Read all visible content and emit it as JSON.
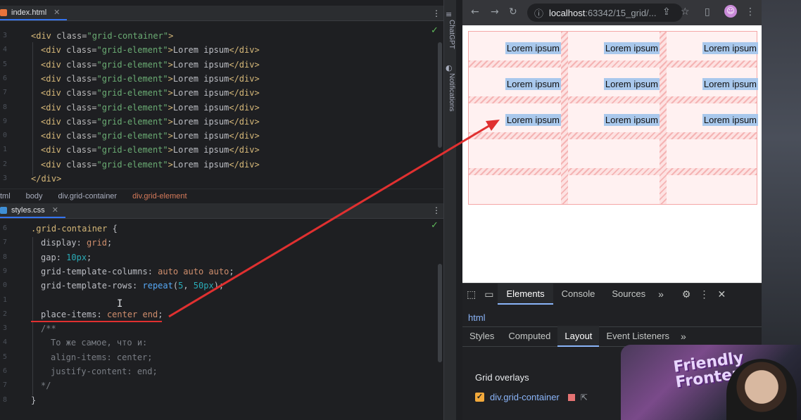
{
  "ide": {
    "html_tab": {
      "label": "index.html"
    },
    "css_tab": {
      "label": "styles.css"
    },
    "html_lines": [
      {
        "n": "3",
        "ind": 0,
        "parts": [
          [
            "tag",
            "<div "
          ],
          [
            "attr",
            "class="
          ],
          [
            "val",
            "\"grid-container\""
          ],
          [
            "tag",
            ">"
          ]
        ]
      },
      {
        "n": "4",
        "ind": 1,
        "parts": [
          [
            "tag",
            "<div "
          ],
          [
            "attr",
            "class="
          ],
          [
            "val",
            "\"grid-element\""
          ],
          [
            "tag",
            ">"
          ],
          [
            "text",
            "Lorem ipsum"
          ],
          [
            "tag",
            "</div>"
          ]
        ]
      },
      {
        "n": "5",
        "ind": 1,
        "parts": [
          [
            "tag",
            "<div "
          ],
          [
            "attr",
            "class="
          ],
          [
            "val",
            "\"grid-element\""
          ],
          [
            "tag",
            ">"
          ],
          [
            "text",
            "Lorem ipsum"
          ],
          [
            "tag",
            "</div>"
          ]
        ]
      },
      {
        "n": "6",
        "ind": 1,
        "parts": [
          [
            "tag",
            "<div "
          ],
          [
            "attr",
            "class="
          ],
          [
            "val",
            "\"grid-element\""
          ],
          [
            "tag",
            ">"
          ],
          [
            "text",
            "Lorem ipsum"
          ],
          [
            "tag",
            "</div>"
          ]
        ]
      },
      {
        "n": "7",
        "ind": 1,
        "parts": [
          [
            "tag",
            "<div "
          ],
          [
            "attr",
            "class="
          ],
          [
            "val",
            "\"grid-element\""
          ],
          [
            "tag",
            ">"
          ],
          [
            "text",
            "Lorem ipsum"
          ],
          [
            "tag",
            "</div>"
          ]
        ]
      },
      {
        "n": "8",
        "ind": 1,
        "parts": [
          [
            "tag",
            "<div "
          ],
          [
            "attr",
            "class="
          ],
          [
            "val",
            "\"grid-element\""
          ],
          [
            "tag",
            ">"
          ],
          [
            "text",
            "Lorem ipsum"
          ],
          [
            "tag",
            "</div>"
          ]
        ]
      },
      {
        "n": "9",
        "ind": 1,
        "parts": [
          [
            "tag",
            "<div "
          ],
          [
            "attr",
            "class="
          ],
          [
            "val",
            "\"grid-element\""
          ],
          [
            "tag",
            ">"
          ],
          [
            "text",
            "Lorem ipsum"
          ],
          [
            "tag",
            "</div>"
          ]
        ]
      },
      {
        "n": "0",
        "ind": 1,
        "parts": [
          [
            "tag",
            "<div "
          ],
          [
            "attr",
            "class="
          ],
          [
            "val",
            "\"grid-element\""
          ],
          [
            "tag",
            ">"
          ],
          [
            "text",
            "Lorem ipsum"
          ],
          [
            "tag",
            "</div>"
          ]
        ]
      },
      {
        "n": "1",
        "ind": 1,
        "parts": [
          [
            "tag",
            "<div "
          ],
          [
            "attr",
            "class="
          ],
          [
            "val",
            "\"grid-element\""
          ],
          [
            "tag",
            ">"
          ],
          [
            "text",
            "Lorem ipsum"
          ],
          [
            "tag",
            "</div>"
          ]
        ]
      },
      {
        "n": "2",
        "ind": 1,
        "parts": [
          [
            "tag",
            "<div "
          ],
          [
            "attr",
            "class="
          ],
          [
            "val",
            "\"grid-element\""
          ],
          [
            "tag",
            ">"
          ],
          [
            "text",
            "Lorem ipsum"
          ],
          [
            "tag",
            "</div>"
          ]
        ]
      },
      {
        "n": "3",
        "ind": 0,
        "parts": [
          [
            "tag",
            "</div>"
          ]
        ]
      }
    ],
    "breadcrumbs": [
      "tml",
      "body",
      "div.grid-container",
      "div.grid-element"
    ],
    "css_lines": [
      {
        "n": "6",
        "ind": 0,
        "parts": [
          [
            "sel",
            ".grid-container "
          ],
          [
            "text",
            "{"
          ]
        ]
      },
      {
        "n": "7",
        "ind": 1,
        "parts": [
          [
            "prop",
            "display"
          ],
          [
            "text",
            ": "
          ],
          [
            "kw",
            "grid"
          ],
          [
            "text",
            ";"
          ]
        ]
      },
      {
        "n": "8",
        "ind": 1,
        "parts": [
          [
            "prop",
            "gap"
          ],
          [
            "text",
            ": "
          ],
          [
            "num",
            "10px"
          ],
          [
            "text",
            ";"
          ]
        ]
      },
      {
        "n": "9",
        "ind": 1,
        "parts": [
          [
            "prop",
            "grid-template-columns"
          ],
          [
            "text",
            ": "
          ],
          [
            "kw",
            "auto auto auto"
          ],
          [
            "text",
            ";"
          ]
        ]
      },
      {
        "n": "0",
        "ind": 1,
        "parts": [
          [
            "prop",
            "grid-template-rows"
          ],
          [
            "text",
            ": "
          ],
          [
            "fn",
            "repeat"
          ],
          [
            "text",
            "("
          ],
          [
            "num",
            "5"
          ],
          [
            "text",
            ", "
          ],
          [
            "num",
            "50px"
          ],
          [
            "text",
            ");"
          ]
        ]
      },
      {
        "n": "1",
        "ind": 0,
        "parts": []
      },
      {
        "n": "2",
        "ind": 1,
        "parts": [
          [
            "prop",
            "place-items"
          ],
          [
            "text",
            ": "
          ],
          [
            "kw",
            "center end"
          ],
          [
            "text",
            ";"
          ]
        ]
      },
      {
        "n": "3",
        "ind": 1,
        "parts": [
          [
            "cm",
            "/**"
          ]
        ]
      },
      {
        "n": "4",
        "ind": 2,
        "parts": [
          [
            "cm",
            "То же самое, что и:"
          ]
        ]
      },
      {
        "n": "5",
        "ind": 2,
        "parts": [
          [
            "cm",
            "align-items: center;"
          ]
        ]
      },
      {
        "n": "6",
        "ind": 2,
        "parts": [
          [
            "cm",
            "justify-content: end;"
          ]
        ]
      },
      {
        "n": "7",
        "ind": 1,
        "parts": [
          [
            "cm",
            "*/"
          ]
        ]
      },
      {
        "n": "8",
        "ind": 0,
        "parts": [
          [
            "text",
            "}"
          ]
        ]
      }
    ],
    "side_labels": {
      "chatgpt": "ChatGPT",
      "notifications": "Notifications"
    }
  },
  "browser": {
    "url_host": "localhost",
    "url_path": ":63342/15_grid/...",
    "cell_text": "Lorem ipsum",
    "cells": [
      [
        "Lorem ipsum",
        "Lorem ipsum",
        "Lorem ipsum"
      ],
      [
        "Lorem ipsum",
        "Lorem ipsum",
        "Lorem ipsum"
      ],
      [
        "Lorem ipsum",
        "Lorem ipsum",
        "Lorem ipsum"
      ]
    ]
  },
  "devtools": {
    "tabs": [
      "Elements",
      "Console",
      "Sources"
    ],
    "active_tab": "Elements",
    "crumb": "html",
    "panel_tabs": [
      "Styles",
      "Computed",
      "Layout",
      "Event Listeners"
    ],
    "active_panel_tab": "Layout",
    "overlays_title": "Grid overlays",
    "overlay_item": "div.grid-container",
    "overlay_color": "#e57373"
  },
  "webcam": {
    "text_line1": "Friendly",
    "text_line2": "Frontend"
  },
  "colors": {
    "annotation": "#e03030",
    "accent": "#3574f0"
  }
}
